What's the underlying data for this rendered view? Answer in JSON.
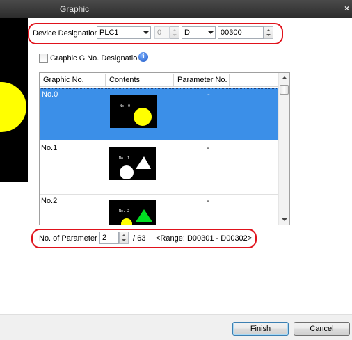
{
  "window": {
    "title": "Graphic",
    "close_glyph": "×"
  },
  "device": {
    "label": "Device Designation",
    "plc": "PLC1",
    "station": "0",
    "device_type": "D",
    "address": "00300"
  },
  "graphic_g": {
    "label": "Graphic G No. Designation",
    "checked": false,
    "info_icon": "info-icon"
  },
  "table": {
    "columns": [
      "Graphic No.",
      "Contents",
      "Parameter No."
    ],
    "rows": [
      {
        "no": "No.0",
        "thumb_label": "No. 0",
        "param": "-",
        "selected": true
      },
      {
        "no": "No.1",
        "thumb_label": "No. 1",
        "param": "-",
        "selected": false
      },
      {
        "no": "No.2",
        "thumb_label": "No. 2",
        "param": "-",
        "selected": false
      }
    ]
  },
  "parameter": {
    "label": "No. of Parameter",
    "value": "2",
    "total": "/ 63",
    "range": "<Range: D00301 - D00302>"
  },
  "buttons": {
    "finish": "Finish",
    "cancel": "Cancel"
  },
  "colors": {
    "selection": "#3b8fe8",
    "highlight_ring": "#e0121b",
    "shape_yellow": "#ffff00",
    "shape_green": "#00dd22"
  }
}
